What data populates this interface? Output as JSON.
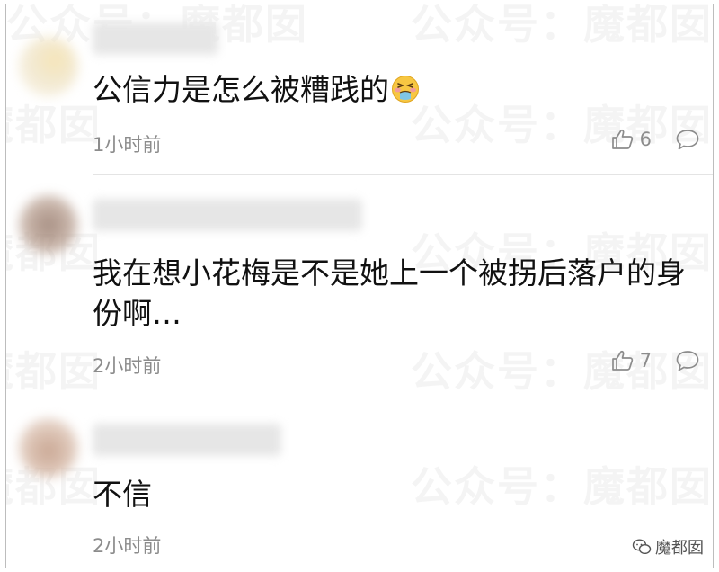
{
  "watermark": {
    "text_a": "公众号：魔都囡",
    "text_b": "魔都囡"
  },
  "comments": [
    {
      "text": "公信力是怎么被糟践的",
      "emoji": "weary-face-emoji",
      "time": "1小时前",
      "likes": "6"
    },
    {
      "text": "我在想小花梅是不是她上一个被拐后落户的身份啊…",
      "time": "2小时前",
      "likes": "7"
    },
    {
      "text": "不信",
      "time": "2小时前"
    }
  ],
  "brand": {
    "label": "魔都囡"
  },
  "colors": {
    "text": "#111111",
    "meta": "#8c8c8c",
    "divider": "#e4e4e4"
  }
}
